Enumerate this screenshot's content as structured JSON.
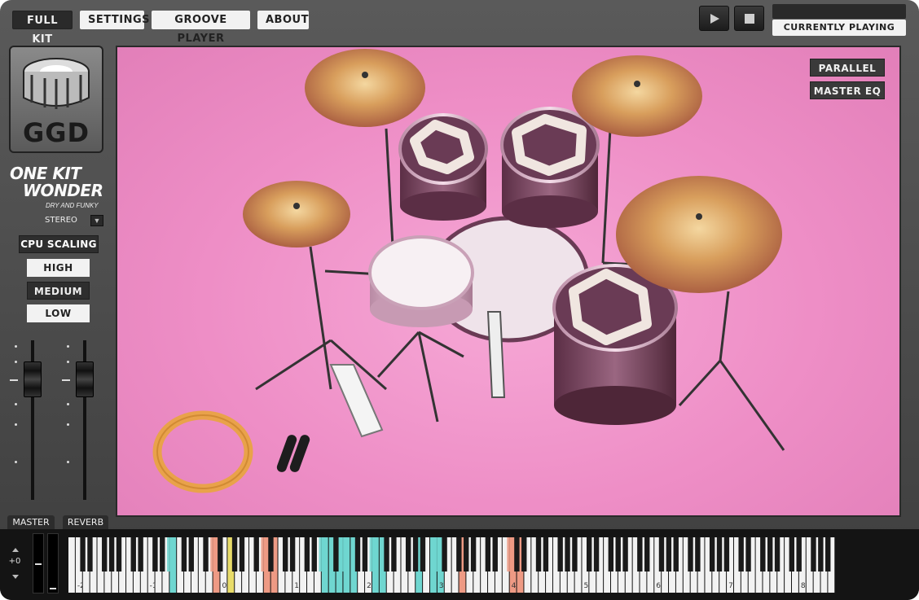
{
  "header": {
    "tabs": [
      {
        "label": "FULL KIT",
        "active": true
      },
      {
        "label": "SETTINGS",
        "active": false
      },
      {
        "label": "GROOVE PLAYER",
        "active": false
      },
      {
        "label": "ABOUT",
        "active": false
      }
    ],
    "transport": {
      "play_icon": "play-icon",
      "stop_icon": "stop-icon"
    },
    "now_playing_label": "CURRENTLY PLAYING"
  },
  "left_panel": {
    "logo_text": "GGD",
    "product_title_line1": "ONE KIT",
    "product_title_line2": "WONDER",
    "product_subtitle": "DRY AND FUNKY",
    "stereo_label": "STEREO",
    "cpu_scaling_label": "CPU SCALING",
    "cpu_options": [
      {
        "label": "HIGH",
        "selected": false
      },
      {
        "label": "MEDIUM",
        "selected": true
      },
      {
        "label": "LOW",
        "selected": false
      }
    ],
    "bottom_tabs": [
      "MASTER",
      "REVERB"
    ]
  },
  "kit_view": {
    "buttons": [
      "PARALLEL",
      "MASTER EQ"
    ]
  },
  "keyboard": {
    "octave_shift": "+0",
    "octave_labels": [
      "-2",
      "-1",
      "0",
      "1",
      "2",
      "3",
      "4",
      "5",
      "6",
      "7",
      "8"
    ],
    "colors": {
      "cyan": "#6fd6d0",
      "salmon": "#ee9a84",
      "yellow": "#e8dc6a"
    }
  },
  "colors": {
    "accent_pink": "#ee8ec6",
    "cymbal_gold": "#d9a060",
    "panel_dark": "#3e3e3e"
  }
}
